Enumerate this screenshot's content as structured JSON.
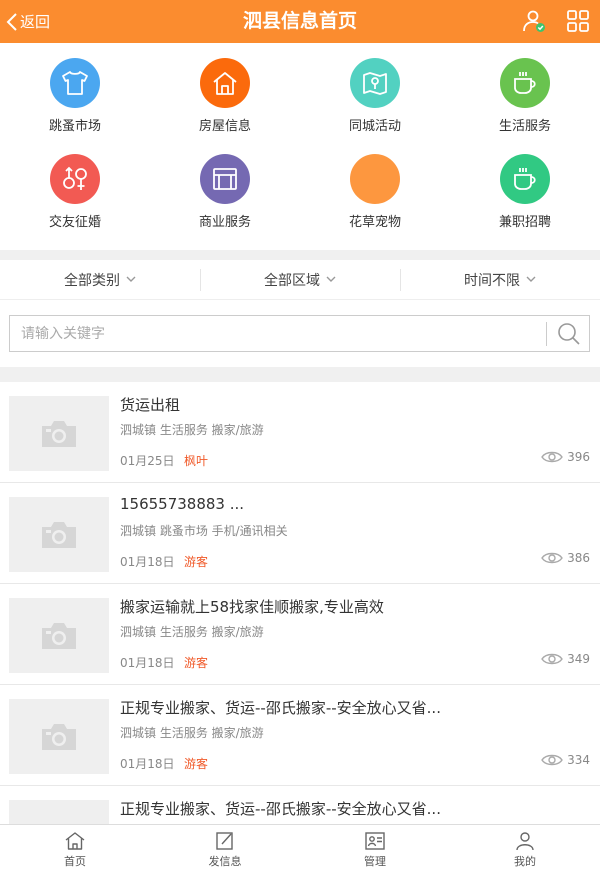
{
  "header": {
    "back_label": "返回",
    "title": "泗县信息首页",
    "user_icon": "user-check-icon",
    "grid_icon": "grid-icon"
  },
  "categories": [
    {
      "label": "跳蚤市场",
      "color": "#4ba7f0",
      "icon": "shirt-icon"
    },
    {
      "label": "房屋信息",
      "color": "#fb6a0c",
      "icon": "house-icon"
    },
    {
      "label": "同城活动",
      "color": "#52d1c1",
      "icon": "map-pin-icon"
    },
    {
      "label": "生活服务",
      "color": "#69c34f",
      "icon": "cup-icon"
    },
    {
      "label": "交友征婚",
      "color": "#f25a53",
      "icon": "gender-icon"
    },
    {
      "label": "商业服务",
      "color": "#7569b2",
      "icon": "store-icon"
    },
    {
      "label": "花草宠物",
      "color": "#fd973f",
      "icon": ""
    },
    {
      "label": "兼职招聘",
      "color": "#31c983",
      "icon": "cup-icon"
    }
  ],
  "filters": [
    "全部类别",
    "全部区域",
    "时间不限"
  ],
  "search": {
    "placeholder": "请输入关键字"
  },
  "listings": [
    {
      "title": "货运出租",
      "meta": "泗城镇 生活服务 搬家/旅游",
      "date": "01月25日",
      "user": "枫叶",
      "views": "396"
    },
    {
      "title": "15655738883 ...",
      "meta": "泗城镇 跳蚤市场 手机/通讯相关",
      "date": "01月18日",
      "user": "游客",
      "views": "386"
    },
    {
      "title": "搬家运输就上58找家佳顺搬家,专业高效",
      "meta": "泗城镇 生活服务 搬家/旅游",
      "date": "01月18日",
      "user": "游客",
      "views": "349"
    },
    {
      "title": "正规专业搬家、货运--邵氏搬家--安全放心又省...",
      "meta": "泗城镇 生活服务 搬家/旅游",
      "date": "01月18日",
      "user": "游客",
      "views": "334"
    },
    {
      "title": "正规专业搬家、货运--邵氏搬家--安全放心又省...",
      "meta": "",
      "date": "",
      "user": "",
      "views": ""
    }
  ],
  "tabbar": [
    {
      "label": "首页",
      "icon": "home-icon"
    },
    {
      "label": "发信息",
      "icon": "edit-icon"
    },
    {
      "label": "管理",
      "icon": "id-card-icon"
    },
    {
      "label": "我的",
      "icon": "person-icon"
    }
  ],
  "colors": {
    "primary": "#fb8c2f",
    "user_highlight": "#f05a2a"
  }
}
